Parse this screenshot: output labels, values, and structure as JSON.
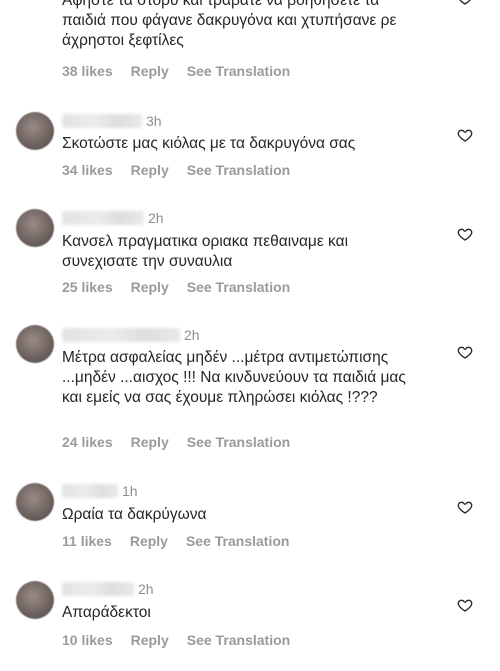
{
  "comments": [
    {
      "time": "",
      "text": "Αφήστε τα στορυ και τραβάτε να βοηθήσετε τα παιδιά που φάγανε δακρυγόνα και χτυπήσανε ρε άχρηστοι ξεφτίλες",
      "likes": "38 likes",
      "reply": "Reply",
      "translate": "See Translation"
    },
    {
      "time": "3h",
      "text": "Σκοτώστε μας κιόλας με τα δακρυγόνα σας",
      "likes": "34 likes",
      "reply": "Reply",
      "translate": "See Translation"
    },
    {
      "time": "2h",
      "text": "Κανσελ πραγματικα οριακα πεθαιναμε και συνεχισατε την συναυλια",
      "likes": "25 likes",
      "reply": "Reply",
      "translate": "See Translation"
    },
    {
      "time": "2h",
      "text": "Μέτρα ασφαλείας μηδέν ...μέτρα αντιμετώπισης ...μηδέν ...αισχος !!! Να κινδυνεύουν τα παιδιά μας και εμείς να σας έχουμε πληρώσει κιόλας !???",
      "likes": "24 likes",
      "reply": "Reply",
      "translate": "See Translation"
    },
    {
      "time": "1h",
      "text": "Ωραία τα δακρύγωνα",
      "likes": "11 likes",
      "reply": "Reply",
      "translate": "See Translation"
    },
    {
      "time": "2h",
      "text": "Απαράδεκτοι",
      "likes": "10 likes",
      "reply": "Reply",
      "translate": "See Translation"
    }
  ],
  "icons": {
    "like": "heart-outline-icon"
  },
  "colors": {
    "text": "#262626",
    "secondary": "#8e8e8e"
  }
}
